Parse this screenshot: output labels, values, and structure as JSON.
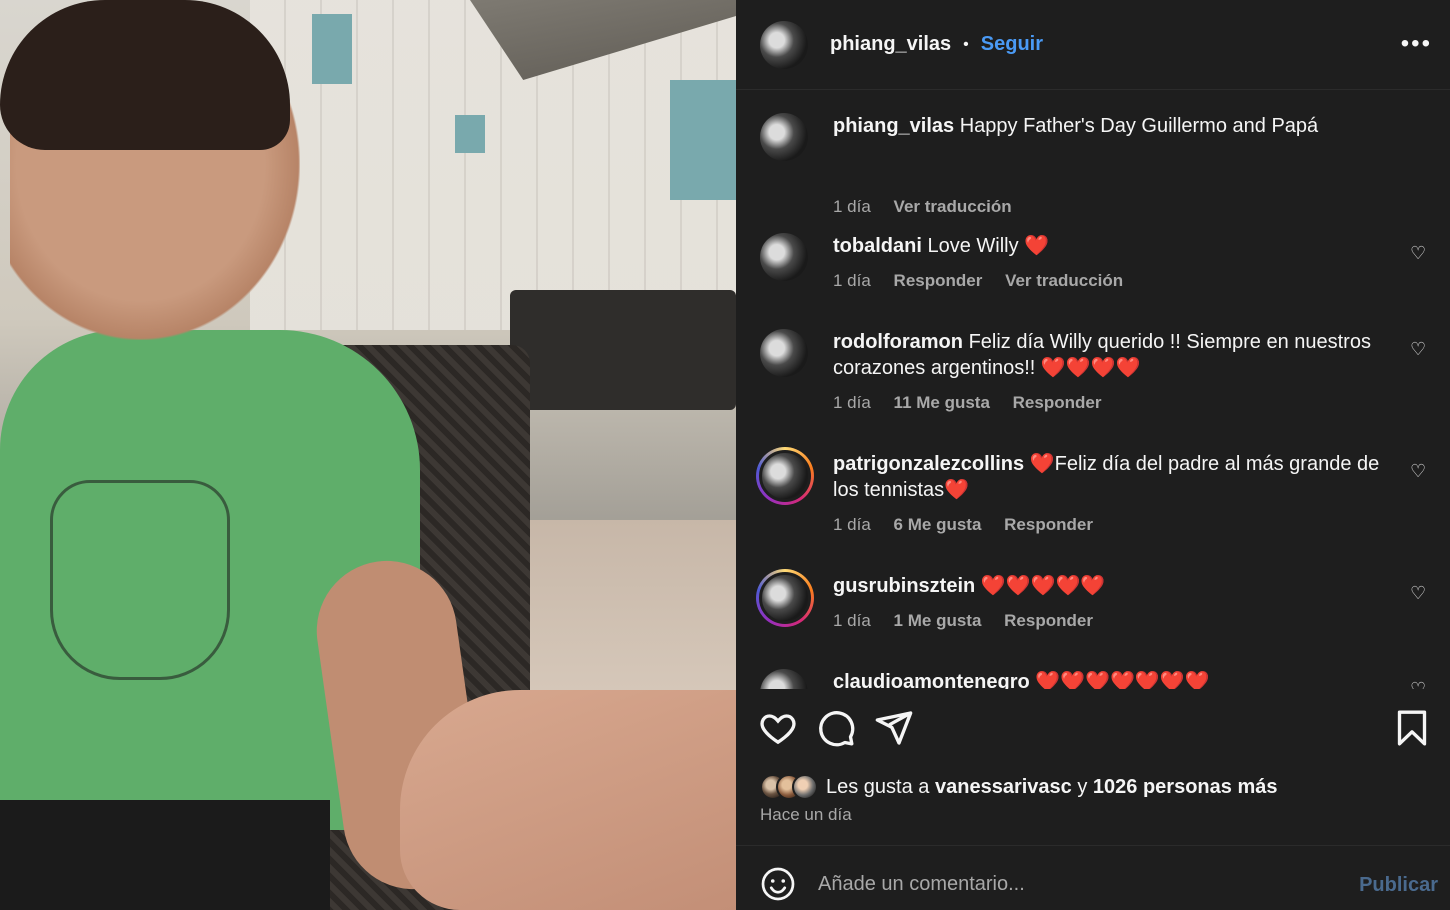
{
  "post": {
    "author": "phiang_vilas",
    "follow_label": "Seguir",
    "separator": "•",
    "more_label": "•••"
  },
  "caption": {
    "author": "phiang_vilas",
    "text": "Happy Father's Day Guillermo and Papá",
    "time": "1 día",
    "translate_label": "Ver traducción"
  },
  "comments": [
    {
      "author": "tobaldani",
      "text": "Love Willy ❤️",
      "time": "1 día",
      "likes": "",
      "reply_label": "Responder",
      "translate_label": "Ver traducción"
    },
    {
      "author": "rodolforamon",
      "text": "Feliz día Willy querido !! Siempre en nuestros corazones argentinos!! ❤️❤️❤️❤️",
      "time": "1 día",
      "likes": "11 Me gusta",
      "reply_label": "Responder"
    },
    {
      "author": "patrigonzalezcollins",
      "text": "❤️Feliz día del padre al más grande de los tennistas❤️",
      "time": "1 día",
      "likes": "6 Me gusta",
      "reply_label": "Responder"
    },
    {
      "author": "gusrubinsztein",
      "text": "❤️❤️❤️❤️❤️",
      "time": "1 día",
      "likes": "1 Me gusta",
      "reply_label": "Responder"
    },
    {
      "author": "claudioamontenegro",
      "text": "❤️❤️❤️❤️❤️❤️❤️"
    }
  ],
  "likes": {
    "prefix": "Les gusta a",
    "user": "vanessarivasc",
    "conj": "y",
    "others": "1026 personas más"
  },
  "posted_time": "Hace un día",
  "composer": {
    "placeholder": "Añade un comentario...",
    "publish_label": "Publicar"
  },
  "colors": {
    "accent": "#4a9af5",
    "heart": "#ff3040",
    "background": "#1e1e1e"
  }
}
